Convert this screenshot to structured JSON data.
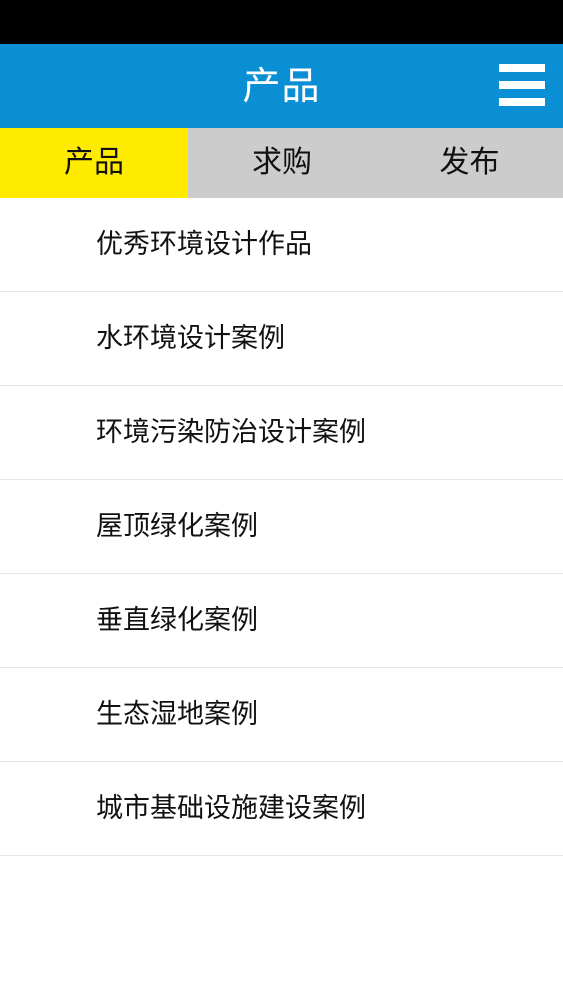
{
  "header": {
    "title": "产品",
    "menu_icon": "hamburger-menu-icon"
  },
  "tabs": [
    {
      "label": "产品",
      "active": true
    },
    {
      "label": "求购",
      "active": false
    },
    {
      "label": "发布",
      "active": false
    }
  ],
  "colors": {
    "header_bg": "#0a8fd4",
    "active_tab_bg": "#ffeb00",
    "tab_bar_bg": "#cccccc"
  },
  "list": {
    "items": [
      {
        "label": "优秀环境设计作品"
      },
      {
        "label": "水环境设计案例"
      },
      {
        "label": "环境污染防治设计案例"
      },
      {
        "label": "屋顶绿化案例"
      },
      {
        "label": "垂直绿化案例"
      },
      {
        "label": "生态湿地案例"
      },
      {
        "label": "城市基础设施建设案例"
      }
    ]
  }
}
